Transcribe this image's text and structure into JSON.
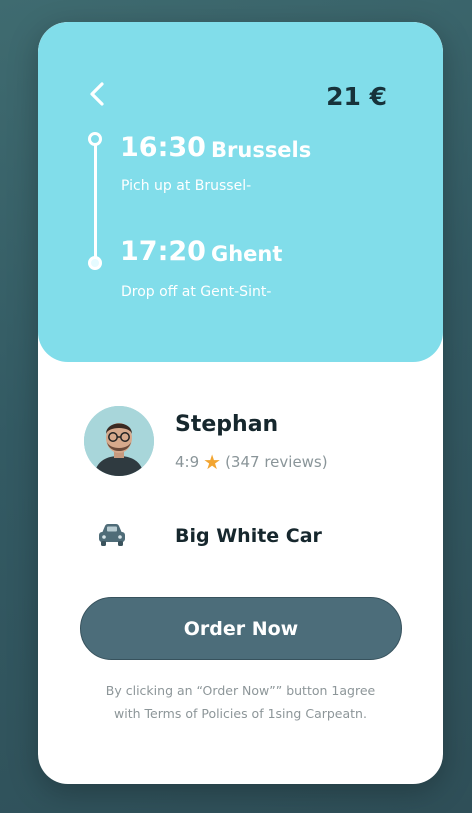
{
  "trip": {
    "price": "21 €",
    "pickup": {
      "time": "16:30",
      "city": "Brussels",
      "detail": "Pich up at Brussel-"
    },
    "dropoff": {
      "time": "17:20",
      "city": "Ghent",
      "detail": "Drop off at Gent-Sint-"
    }
  },
  "driver": {
    "name": "Stephan",
    "rating": "4:9",
    "reviews": "(347  reviews)"
  },
  "vehicle": {
    "label": "Big White Car",
    "icon": "car-icon"
  },
  "actions": {
    "order_label": "Order Now"
  },
  "terms": {
    "line1": "By clicking an “Order Now”” button 1agree",
    "line2": "with Terms of Policies of 1sing Carpeatn."
  },
  "colors": {
    "header": "#81ddea",
    "button": "#4c6d7a",
    "star": "#f2a531"
  }
}
